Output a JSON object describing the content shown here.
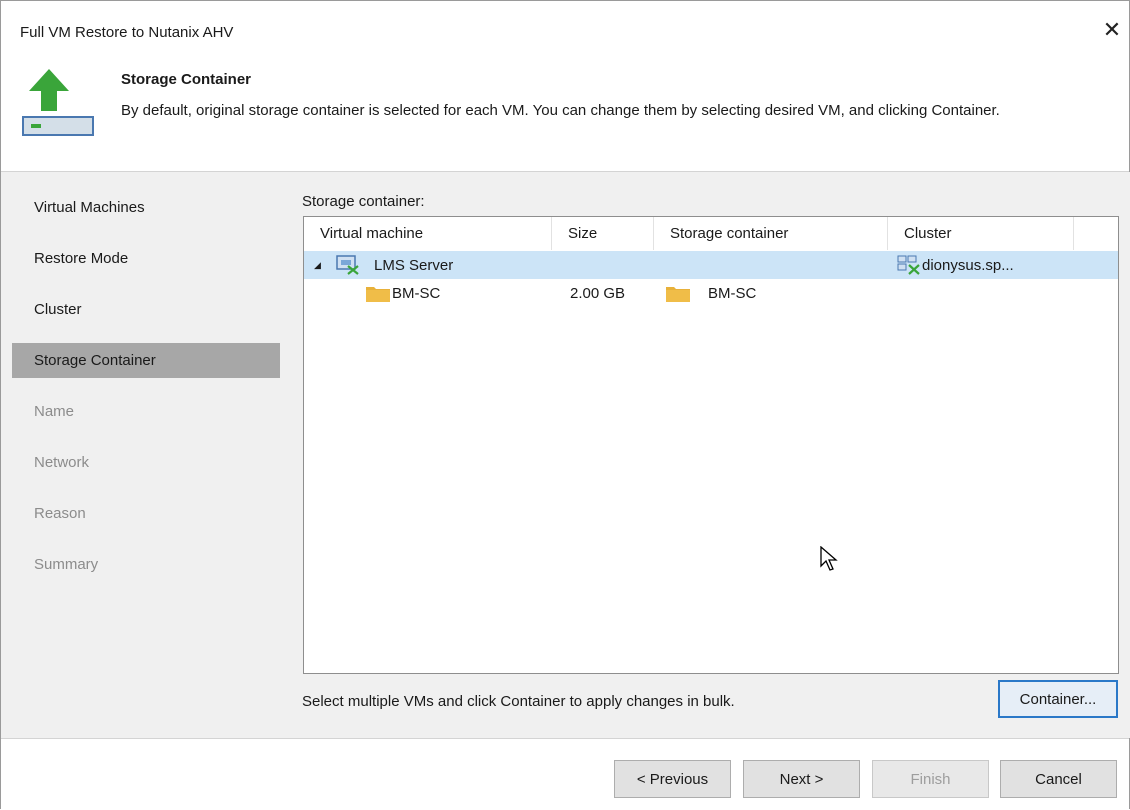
{
  "window": {
    "title": "Full VM Restore to Nutanix AHV",
    "close_glyph": "✕"
  },
  "header": {
    "title": "Storage Container",
    "description": "By default, original storage container is selected for each VM. You can change them by selecting desired VM, and clicking Container.",
    "icon": "restore-arrow-icon"
  },
  "sidebar": {
    "items": [
      {
        "label": "Virtual Machines",
        "state": "normal"
      },
      {
        "label": "Restore Mode",
        "state": "normal"
      },
      {
        "label": "Cluster",
        "state": "normal"
      },
      {
        "label": "Storage Container",
        "state": "active"
      },
      {
        "label": "Name",
        "state": "disabled"
      },
      {
        "label": "Network",
        "state": "disabled"
      },
      {
        "label": "Reason",
        "state": "disabled"
      },
      {
        "label": "Summary",
        "state": "disabled"
      }
    ]
  },
  "main": {
    "section_label": "Storage container:",
    "columns": [
      "Virtual machine",
      "Size",
      "Storage container",
      "Cluster"
    ],
    "rows": [
      {
        "expander": "◢",
        "vm": "LMS Server",
        "size": "",
        "container": "",
        "cluster": "dionysus.sp...",
        "selected": true
      },
      {
        "expander": "",
        "vm": "BM-SC",
        "size": "2.00 GB",
        "container": "BM-SC",
        "cluster": "",
        "selected": false
      }
    ],
    "hint": "Select multiple VMs and click Container to apply changes in bulk.",
    "container_button": "Container..."
  },
  "footer": {
    "previous": "< Previous",
    "next": "Next >",
    "finish": "Finish",
    "cancel": "Cancel"
  },
  "colors": {
    "accent": "#2a78c8",
    "selection": "#cce4f7",
    "folder": "#e8b13a",
    "arrow": "#3aa53a"
  }
}
